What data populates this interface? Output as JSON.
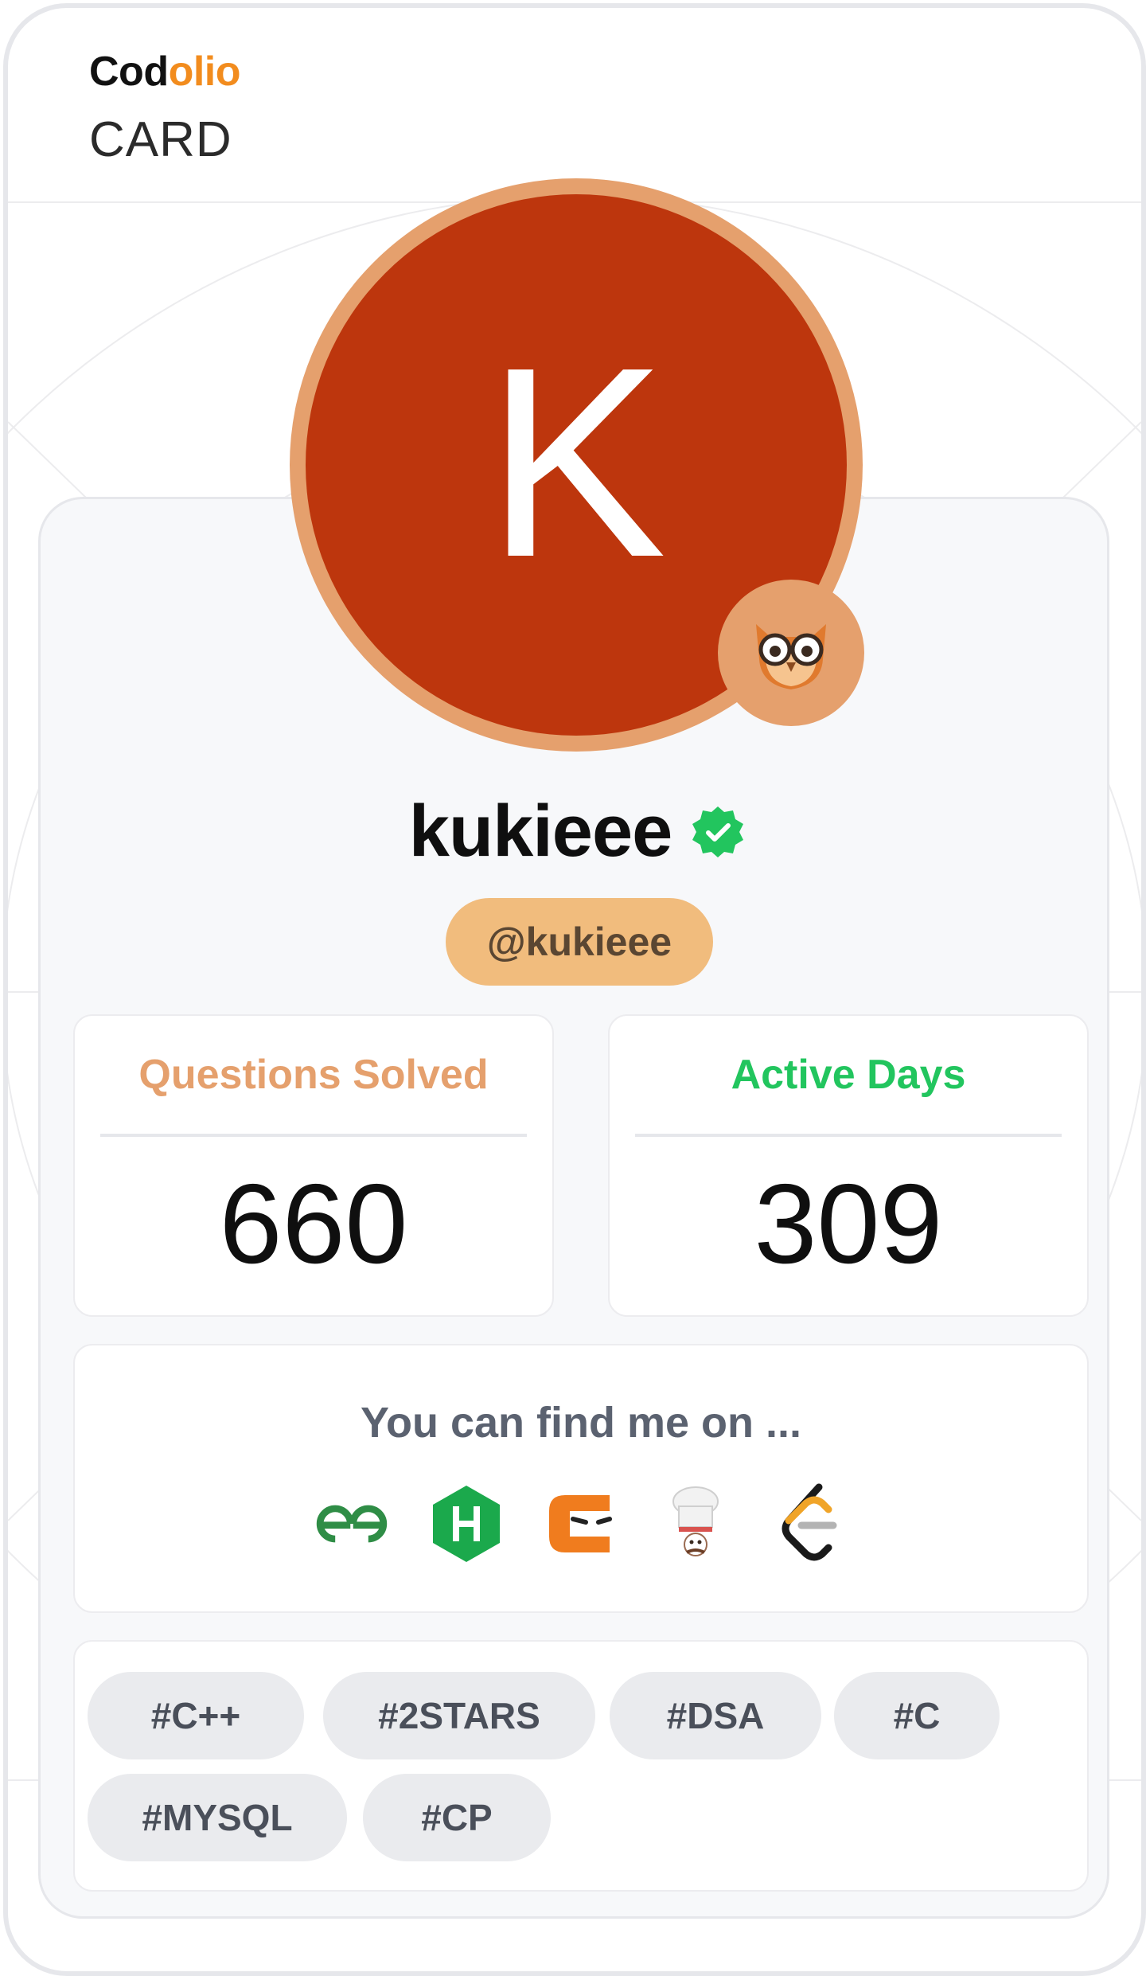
{
  "brand": {
    "part1": "Cod",
    "part2": "olio",
    "label": "CARD"
  },
  "profile": {
    "avatar_letter": "K",
    "name": "kukieee",
    "handle": "@kukieee",
    "verified_icon": "verified-check-icon",
    "badge_icon": "owl-icon"
  },
  "stats": {
    "questions": {
      "label": "Questions Solved",
      "value": "660",
      "color": "#e5a06d"
    },
    "active": {
      "label": "Active Days",
      "value": "309",
      "color": "#22c55e"
    }
  },
  "find": {
    "title": "You can find me on ...",
    "platforms": [
      "geeksforgeeks-icon",
      "hackerrank-icon",
      "codingninjas-icon",
      "codechef-icon",
      "leetcode-icon"
    ]
  },
  "tags": [
    "#C++",
    "#2STARS",
    "#DSA",
    "#C",
    "#MYSQL",
    "#CP"
  ],
  "colors": {
    "accent_orange": "#f28c1e",
    "avatar_bg": "#bd360d",
    "ring": "#e5a06d",
    "handle_bg": "#f1bc7d"
  }
}
